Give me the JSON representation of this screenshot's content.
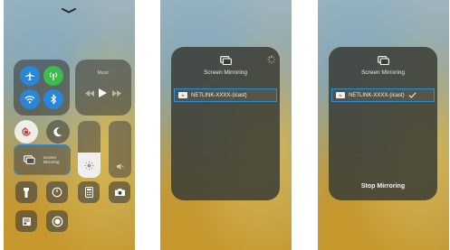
{
  "control_center": {
    "music_label": "Music",
    "screen_mirroring_label": "Screen\nMirroring"
  },
  "panel_searching": {
    "title": "Screen Mirroring",
    "device_badge": "tv",
    "device_name": "NETLINK-XXXX-(icast)"
  },
  "panel_connected": {
    "title": "Screen Mirroring",
    "device_badge": "tv",
    "device_name": "NETLINK-XXXX-(icast)",
    "stop_label": "Stop Mirroring"
  },
  "colors": {
    "selection_border": "#2f8fd2",
    "wifi_blue": "#2a86d9",
    "cellular_green": "#3fba4f"
  },
  "levels": {
    "brightness_fraction": 0.45,
    "volume_fraction": 0.0
  }
}
